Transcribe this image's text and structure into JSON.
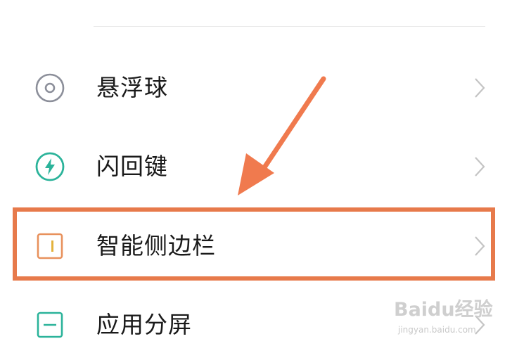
{
  "settings_list": {
    "items": [
      {
        "label": "悬浮球",
        "icon": "floating-ball-icon"
      },
      {
        "label": "闪回键",
        "icon": "flash-back-key-icon"
      },
      {
        "label": "智能侧边栏",
        "icon": "smart-sidebar-icon"
      },
      {
        "label": "应用分屏",
        "icon": "split-screen-icon"
      }
    ],
    "chevron_icon": "chevron-right-icon"
  },
  "annotation": {
    "highlight_color": "#e77a4b",
    "arrow_color": "#f07a4e",
    "highlighted_item": "智能侧边栏"
  },
  "watermark": {
    "brand": "Baidu经验",
    "url": "jingyan.baidu.com"
  },
  "colors": {
    "icon_gray": "#8c8f9a",
    "icon_teal": "#2bb39a",
    "icon_orange": "#e8915c",
    "chevron": "#c4c4c4"
  }
}
